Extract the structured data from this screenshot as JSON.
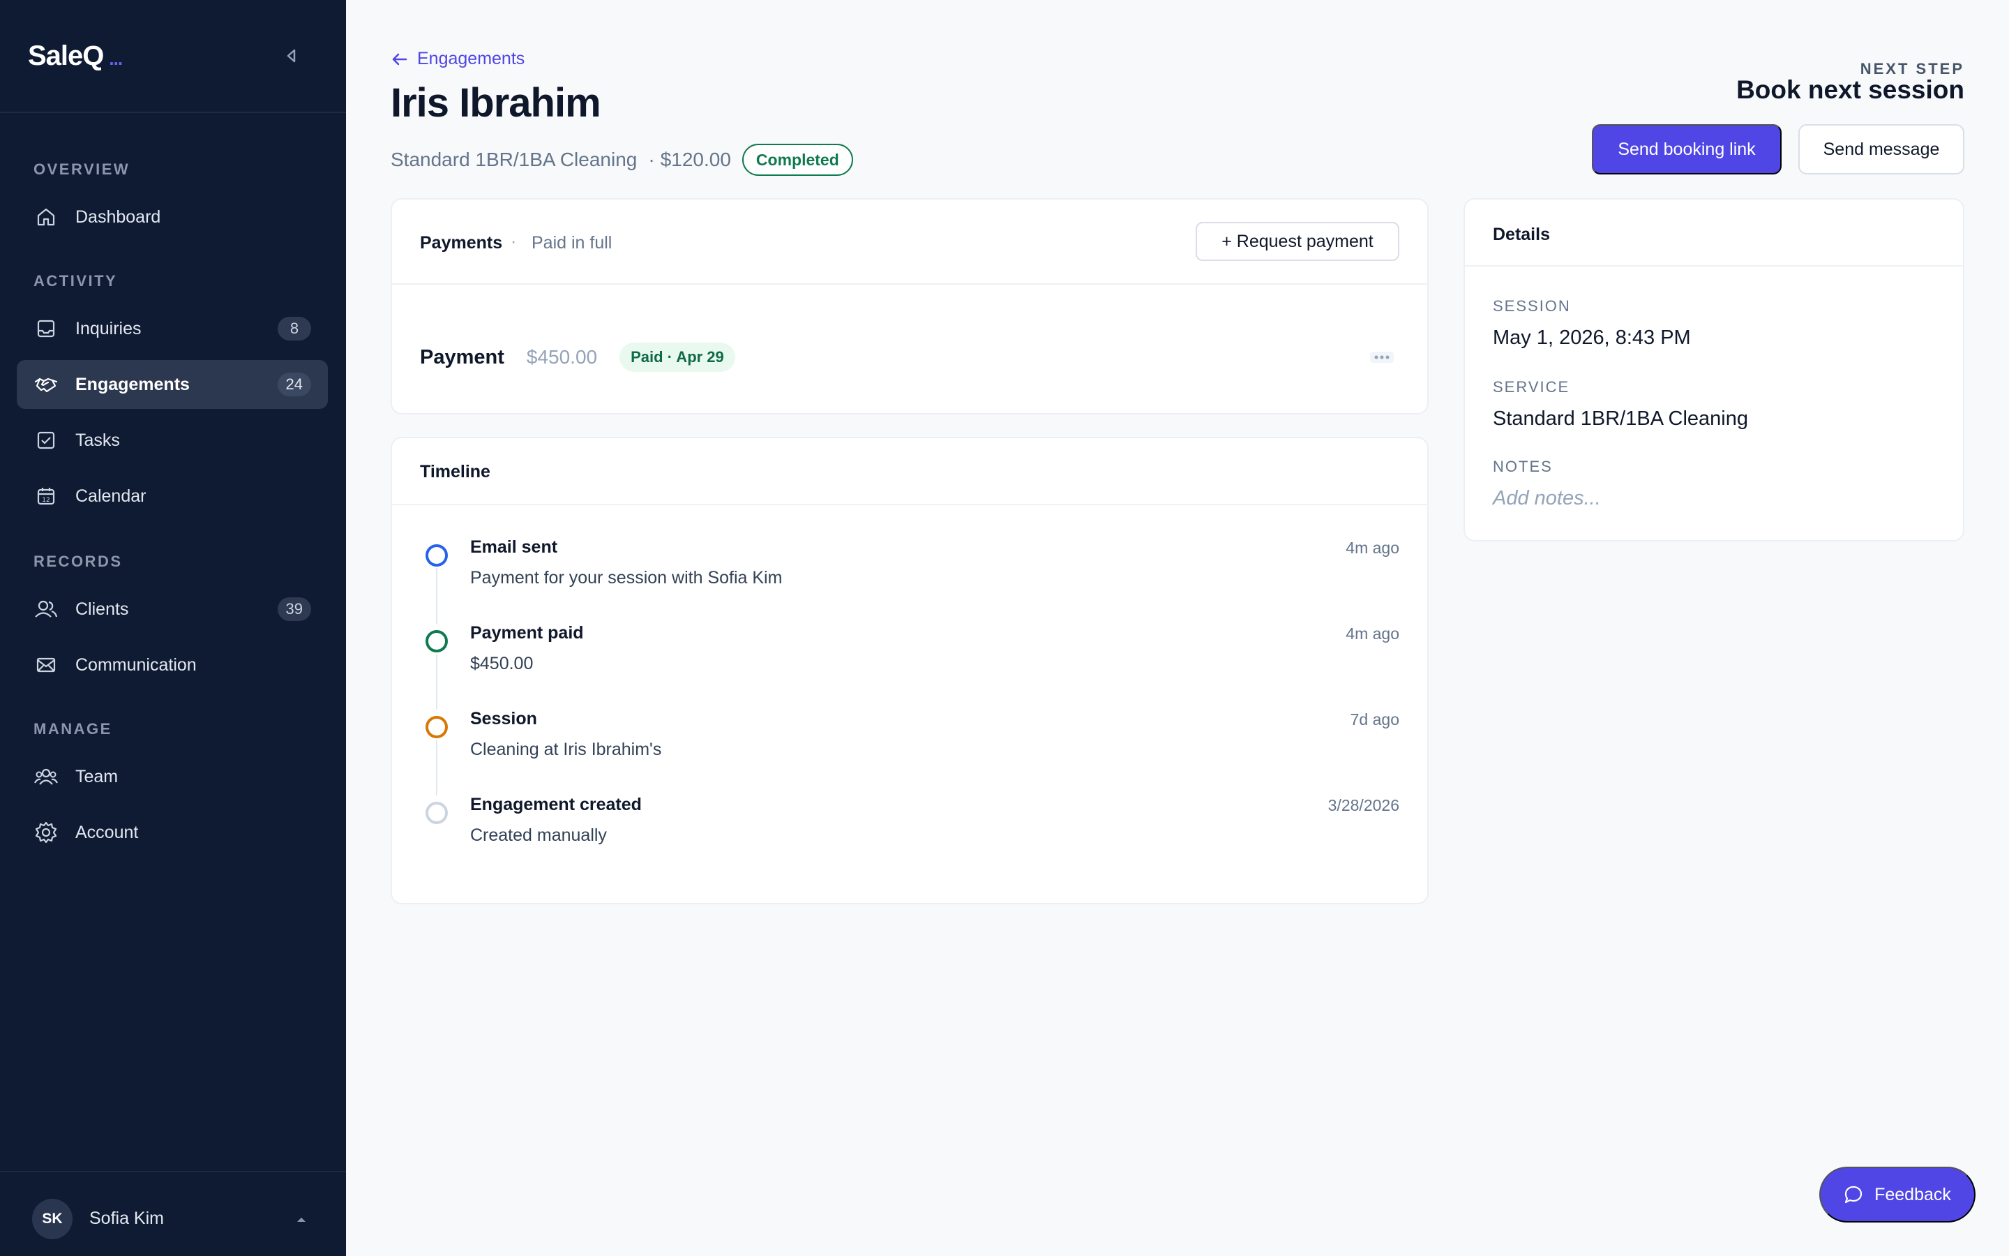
{
  "sidebar": {
    "brand": "SaleQ",
    "brand_suffix": "...",
    "sections": {
      "overview": "OVERVIEW",
      "activity": "ACTIVITY",
      "records": "RECORDS",
      "manage": "MANAGE"
    },
    "items": {
      "dashboard": {
        "label": "Dashboard",
        "icon": "home-icon"
      },
      "inquiries": {
        "label": "Inquiries",
        "count": "8",
        "icon": "inbox-icon"
      },
      "engagements": {
        "label": "Engagements",
        "count": "24",
        "icon": "handshake-icon"
      },
      "tasks": {
        "label": "Tasks",
        "icon": "checkbox-icon"
      },
      "calendar": {
        "label": "Calendar",
        "icon": "calendar-icon"
      },
      "clients": {
        "label": "Clients",
        "count": "39",
        "icon": "users-icon"
      },
      "communication": {
        "label": "Communication",
        "icon": "mail-icon"
      },
      "team": {
        "label": "Team",
        "icon": "team-icon"
      },
      "account": {
        "label": "Account",
        "icon": "gear-icon"
      }
    },
    "user": {
      "initials": "SK",
      "name": "Sofia Kim"
    }
  },
  "header": {
    "back_label": "Engagements",
    "title": "Iris Ibrahim",
    "service": "Standard 1BR/1BA Cleaning",
    "separator": "·",
    "price": "$120.00",
    "status": "Completed",
    "next_step_label": "NEXT STEP",
    "next_step_title": "Book next session",
    "primary_action": "Send booking link",
    "secondary_action": "Send message"
  },
  "payments": {
    "title": "Payments",
    "separator": "·",
    "status": "Paid in full",
    "request_button": "+ Request payment",
    "row": {
      "label": "Payment",
      "amount": "$450.00",
      "badge": "Paid · Apr 29"
    }
  },
  "timeline": {
    "title": "Timeline",
    "items": [
      {
        "title": "Email sent",
        "desc": "Payment for your session with Sofia Kim",
        "time": "4m ago",
        "color": "#2563eb"
      },
      {
        "title": "Payment paid",
        "desc": "$450.00",
        "time": "4m ago",
        "color": "#0f7a4f"
      },
      {
        "title": "Session",
        "desc": "Cleaning at Iris Ibrahim's",
        "time": "7d ago",
        "color": "#d97706"
      },
      {
        "title": "Engagement created",
        "desc": "Created manually",
        "time": "3/28/2026",
        "color": "#cbd5e1"
      }
    ]
  },
  "details": {
    "title": "Details",
    "session_label": "SESSION",
    "session_value": "May 1, 2026, 8:43 PM",
    "service_label": "SERVICE",
    "service_value": "Standard 1BR/1BA Cleaning",
    "notes_label": "NOTES",
    "notes_placeholder": "Add notes..."
  },
  "feedback": {
    "label": "Feedback"
  },
  "colors": {
    "sidebar_bg": "#0f1a33",
    "accent": "#4f46e5",
    "success": "#0f7a4f"
  }
}
